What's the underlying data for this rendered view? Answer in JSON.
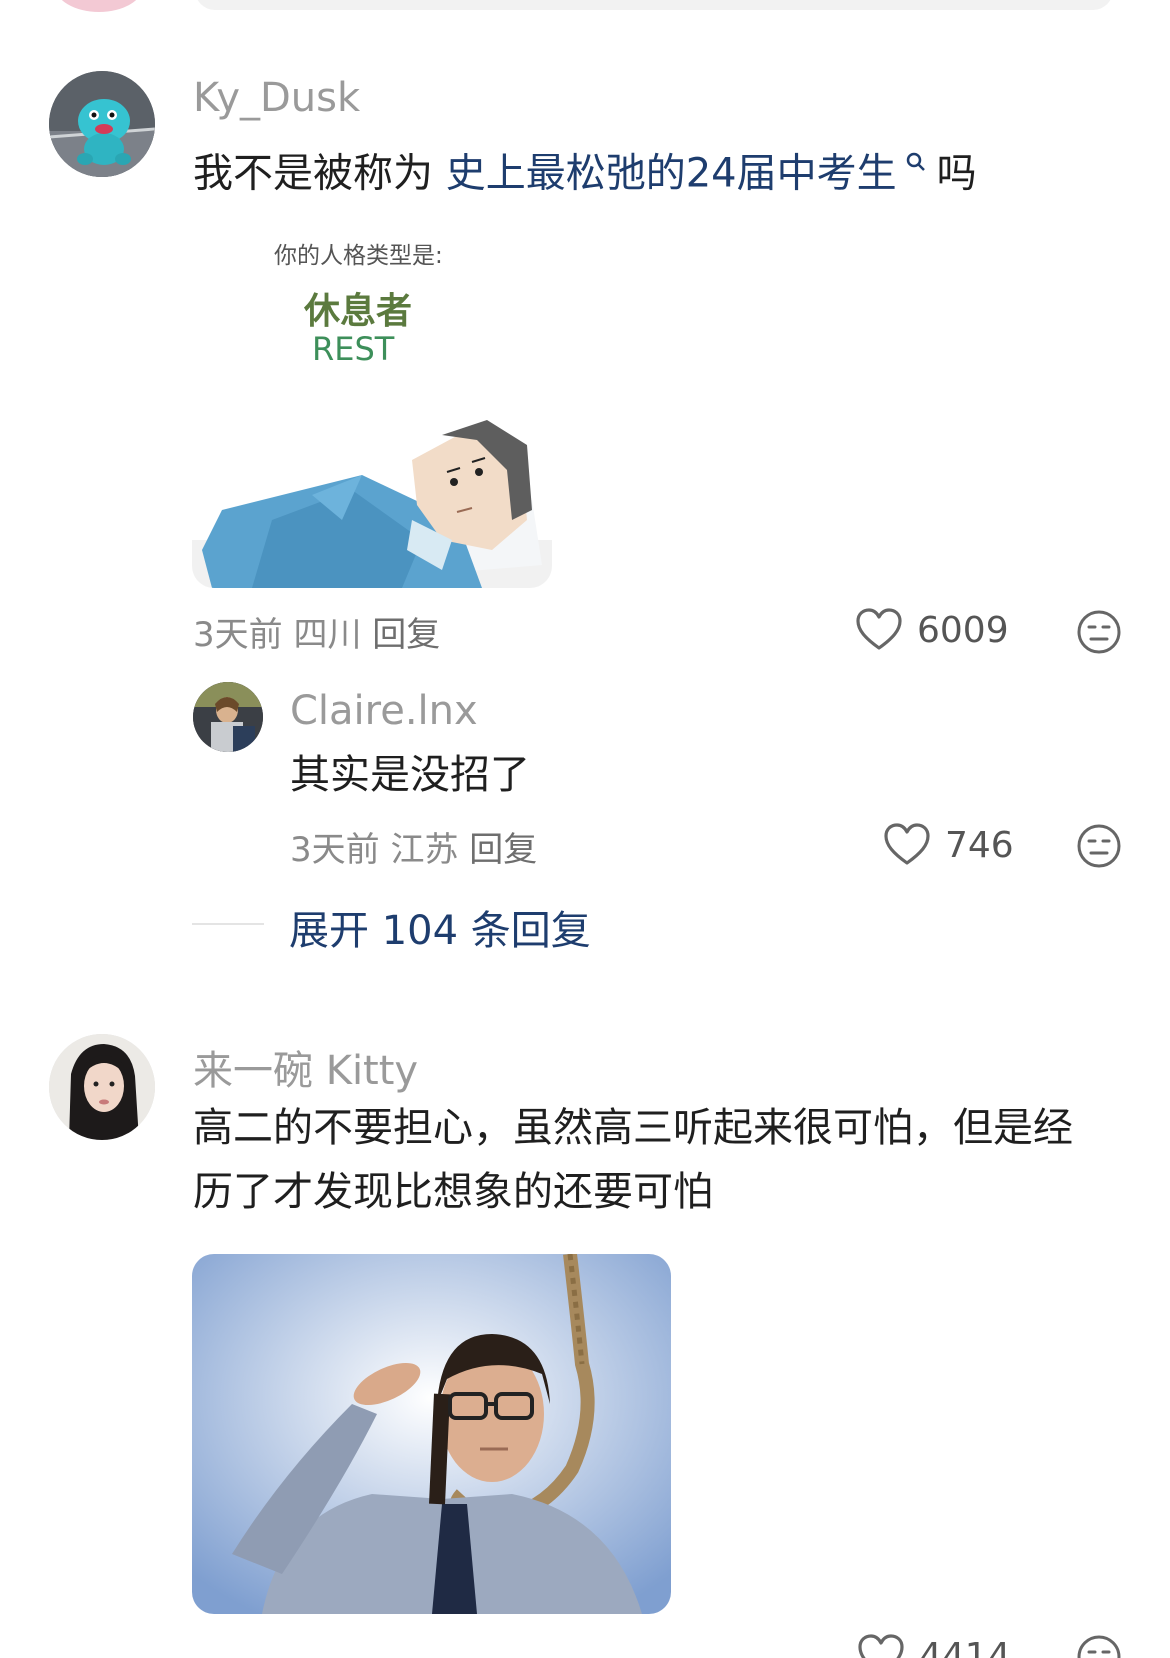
{
  "comments": [
    {
      "username": "Ky_Dusk",
      "text_prefix": "我不是被称为 ",
      "text_link": "史上最松弛的24届中考生",
      "text_suffix": " 吗",
      "image_card": {
        "subtitle": "你的人格类型是:",
        "title": "休息者",
        "title_en": "REST"
      },
      "time": "3天前",
      "location": "四川",
      "reply_label": "回复",
      "likes": "6009",
      "replies": [
        {
          "username": "Claire.lnx",
          "text": "其实是没招了",
          "time": "3天前",
          "location": "江苏",
          "reply_label": "回复",
          "likes": "746"
        }
      ],
      "expand_label": "展开 104 条回复"
    },
    {
      "username": "来一碗 Kitty",
      "text_line1": "高二的不要担心，虽然高三听起来很可怕，但是经",
      "text_line2": "历了才发现比想象的还要可怕",
      "likes_partial": "4414"
    }
  ],
  "icons": {
    "like": "heart-outline-icon",
    "dislike": "meh-face-icon",
    "search_hint": "search-icon"
  },
  "colors": {
    "link": "#1e3d6e",
    "username": "#9a9a9a",
    "meta": "#8a8a8a"
  }
}
